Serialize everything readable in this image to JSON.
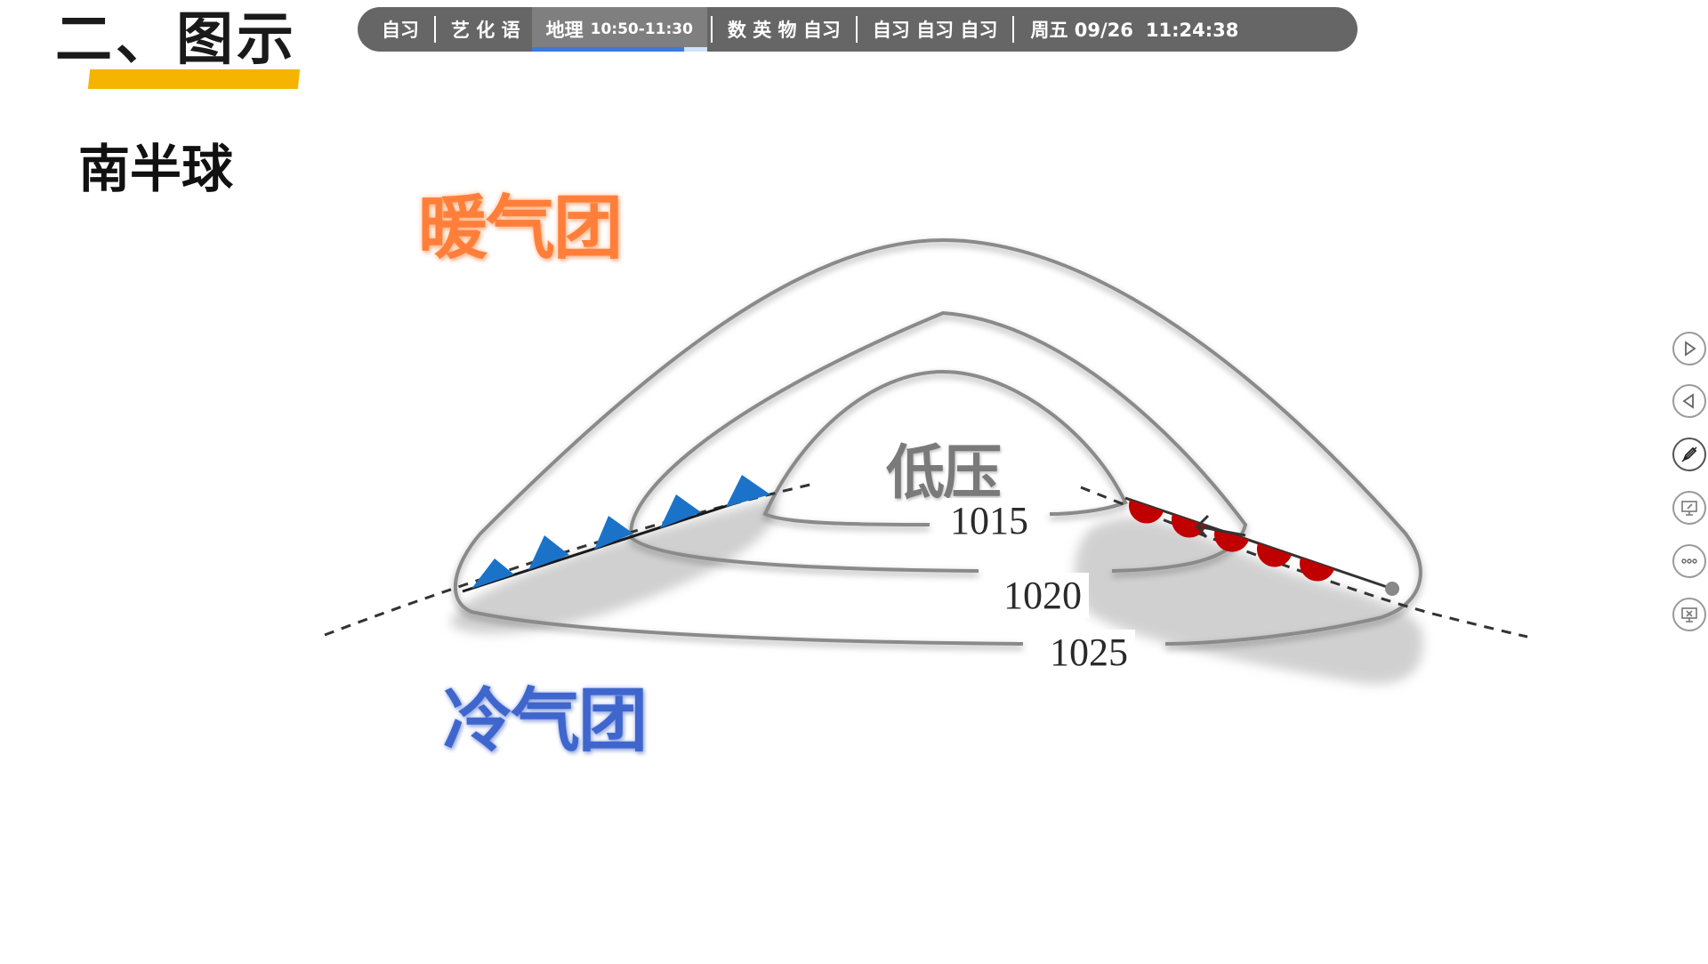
{
  "slide": {
    "title": "二、图示",
    "subtitle": "南半球"
  },
  "schedule": {
    "items": [
      {
        "label": "自习"
      },
      {
        "label": "艺 化 语"
      },
      {
        "label": "地理",
        "time": "10:50-11:30",
        "active": true,
        "progress": 0.87
      },
      {
        "label": "数 英 物 自习"
      },
      {
        "label": "自习  自习  自习"
      }
    ],
    "date": "周五 09/26",
    "clock": "11:24:38"
  },
  "diagram": {
    "warm_air_mass": "暖气团",
    "cold_air_mass": "冷气团",
    "center_label": "低压",
    "isobars": [
      "1015",
      "1020",
      "1025"
    ],
    "cold_front_color": "#1a73c9",
    "warm_front_color": "#c00000"
  },
  "toolbar": {
    "icons": [
      "play-next-icon",
      "play-previous-icon",
      "pen-icon",
      "screen-annotate-icon",
      "more-icon",
      "exit-slideshow-icon"
    ]
  }
}
